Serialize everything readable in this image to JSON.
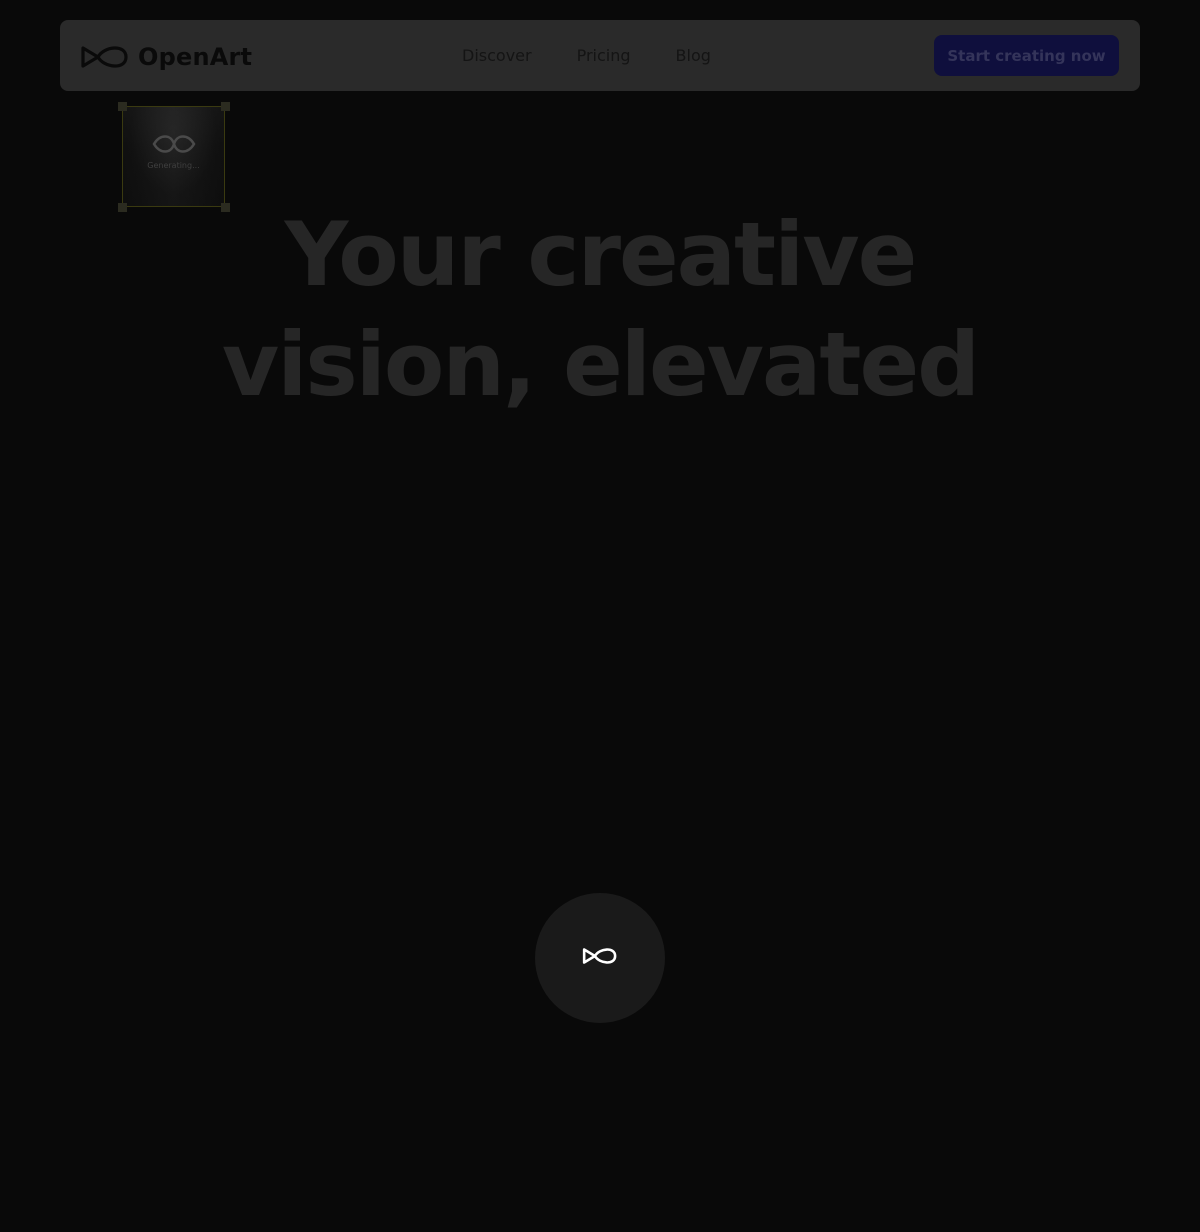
{
  "navbar": {
    "brand": "OpenArt",
    "logo_icon": "openart-infinity-icon",
    "links": [
      "Discover",
      "Pricing",
      "Blog"
    ],
    "cta_label": "Start creating now"
  },
  "generating_card": {
    "icon": "openart-infinity-icon",
    "label": "Generating..."
  },
  "hero": {
    "title_line1": "Your creative",
    "title_line2": "vision, elevated"
  },
  "loader": {
    "icon": "openart-infinity-icon"
  },
  "colors": {
    "background": "#090909",
    "navbar": "#2a2a2a",
    "cta_background": "#0f0f3d",
    "hero_text": "#262626",
    "loader_circle": "#1a1a1a"
  }
}
